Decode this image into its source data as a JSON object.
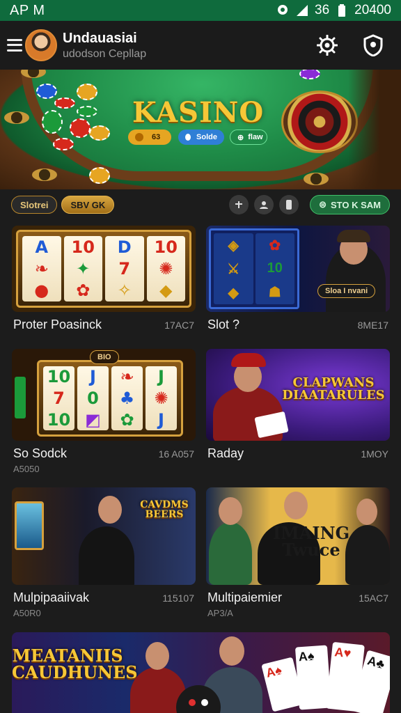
{
  "status_bar": {
    "time": "AP M",
    "battery_text": "36",
    "clock_right": "20400",
    "icons": [
      "location-icon",
      "signal-icon",
      "battery-icon"
    ]
  },
  "header": {
    "title": "Undauasiai",
    "subtitle": "udodson Cepllap",
    "actions": [
      "settings-icon",
      "shield-icon"
    ]
  },
  "banner": {
    "title": "KASINO",
    "buttons": [
      {
        "label": "63",
        "color": "#e6a522"
      },
      {
        "label": "Solde",
        "color": "#2f7fd6"
      },
      {
        "label": "flaw",
        "color": "#1e8a48"
      }
    ]
  },
  "filters": {
    "chips": [
      "Slotrei",
      "SBV GK"
    ],
    "sort_label": "STO K SAM",
    "icon_buttons": [
      "sort-up-icon",
      "user-icon",
      "card-icon"
    ]
  },
  "games": [
    {
      "name": "Proter Poasinck",
      "count": "17AC7",
      "sub": ""
    },
    {
      "name": "Slot ?",
      "count": "8ME17",
      "sub": "",
      "badge": "Sloa I nvani"
    },
    {
      "name": "So Sodck",
      "count": "16 A057",
      "sub": "A5050",
      "badge": "BIO"
    },
    {
      "name": "Raday",
      "count": "1MOY",
      "sub": "",
      "logo": "CLAPWANS DIAATARULES"
    },
    {
      "name": "Mulpipaaiivak",
      "count": "115107",
      "sub": "A50R0",
      "logo": "CAVDMS BEERS"
    },
    {
      "name": "Multipaiemier",
      "count": "15AC7",
      "sub": "AP3/A",
      "logo": "IMAING Twuce"
    },
    {
      "name": "",
      "count": "",
      "sub": "",
      "logo": "MEATANIIS CAUDHUNES"
    }
  ],
  "colors": {
    "status_bar": "#0f6b3d",
    "accent_gold": "#d8a640",
    "accent_green": "#1e6e3c",
    "background": "#1c1c1c"
  }
}
